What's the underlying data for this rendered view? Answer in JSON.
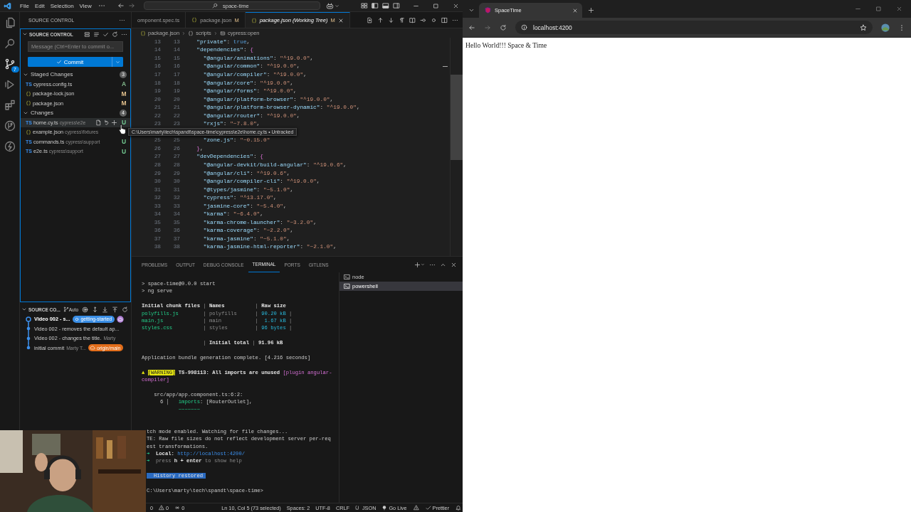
{
  "vscode": {
    "menu": [
      "File",
      "Edit",
      "Selection",
      "View"
    ],
    "command_center": "space-time",
    "activity_bar": [
      {
        "kind": "explorer",
        "selected": false
      },
      {
        "kind": "search",
        "selected": false
      },
      {
        "kind": "scm",
        "selected": true,
        "badge": "7"
      },
      {
        "kind": "run",
        "selected": false
      },
      {
        "kind": "extensions",
        "selected": false
      },
      {
        "kind": "gitlens",
        "selected": false
      },
      {
        "kind": "lightning",
        "selected": false
      }
    ],
    "sidebar": {
      "title": "SOURCE CONTROL",
      "section": "SOURCE CONTROL",
      "message_placeholder": "Message (Ctrl+Enter to commit o...",
      "commit_label": "Commit",
      "groups": [
        {
          "label": "Staged Changes",
          "count": "3",
          "expanded": true,
          "files": [
            {
              "kind": "ts",
              "icon_text": "TS",
              "name": "cypress.config.ts",
              "status": "A",
              "color": "#81b88b",
              "hovered": false
            },
            {
              "kind": "json",
              "name": "package-lock.json",
              "status": "M",
              "color": "#e2c08d",
              "hovered": false
            },
            {
              "kind": "json",
              "name": "package.json",
              "status": "M",
              "color": "#e2c08d",
              "hovered": false
            }
          ]
        },
        {
          "label": "Changes",
          "count": "4",
          "expanded": true,
          "files": [
            {
              "kind": "ts",
              "icon_text": "TS",
              "name": "home.cy.ts",
              "path": "cypress\\e2e",
              "status": "U",
              "color": "#73c991",
              "hovered": true
            },
            {
              "kind": "json",
              "name": "example.json",
              "path": "cypress\\fixtures",
              "hovered": false
            },
            {
              "kind": "ts",
              "icon_text": "TS",
              "name": "commands.ts",
              "path": "cypress\\support",
              "status": "U",
              "color": "#73c991",
              "hovered": false
            },
            {
              "kind": "ts",
              "icon_text": "TS",
              "name": "e2e.ts",
              "path": "cypress\\support",
              "status": "U",
              "color": "#73c991",
              "hovered": false
            }
          ]
        }
      ],
      "graph": {
        "title": "SOURCE CO...",
        "mode": "Auto",
        "commits": [
          {
            "message": "Video 002 - s...",
            "head": true,
            "remote": true,
            "ref": {
              "kind": "local",
              "label": "getting-started",
              "color": "#3a8ee6"
            }
          },
          {
            "message": "Video 002 - removes the default ap...",
            "head": false,
            "remote": false
          },
          {
            "message": "Video 002 - changes the title.",
            "author": "Marty",
            "head": false,
            "remote": false
          },
          {
            "message": "initial commit",
            "author": "Marty T...",
            "head": false,
            "remote": false,
            "ref": {
              "kind": "remote",
              "label": "origin/main",
              "color": "#e26d1a"
            }
          }
        ]
      }
    },
    "editor": {
      "tabs": [
        {
          "label": "omponent.spec.ts",
          "selected": false,
          "preview": false
        },
        {
          "kind": "json",
          "label": "package.json",
          "decoration": "M",
          "selected": false,
          "preview": false
        },
        {
          "kind": "json",
          "label": "package.json (Working Tree)",
          "decoration": "M",
          "selected": true,
          "preview": true
        }
      ],
      "breadcrumbs": [
        {
          "kind": "json",
          "label": "package.json"
        },
        {
          "kind": "object",
          "label": "scripts"
        },
        {
          "kind": "string",
          "label": "cypress:open"
        }
      ],
      "lines": [
        {
          "a": "13",
          "b": "13",
          "code": "  \"private\": true,"
        },
        {
          "a": "14",
          "b": "14",
          "code": "  \"dependencies\": {"
        },
        {
          "a": "15",
          "b": "15",
          "code": "    \"@angular/animations\": \"^19.0.0\","
        },
        {
          "a": "16",
          "b": "16",
          "code": "    \"@angular/common\": \"^19.0.0\","
        },
        {
          "a": "17",
          "b": "17",
          "code": "    \"@angular/compiler\": \"^19.0.0\","
        },
        {
          "a": "18",
          "b": "18",
          "code": "    \"@angular/core\": \"^19.0.0\","
        },
        {
          "a": "19",
          "b": "19",
          "code": "    \"@angular/forms\": \"^19.0.0\","
        },
        {
          "a": "20",
          "b": "20",
          "code": "    \"@angular/platform-browser\": \"^19.0.0\","
        },
        {
          "a": "21",
          "b": "21",
          "code": "    \"@angular/platform-browser-dynamic\": \"^19.0.0\","
        },
        {
          "a": "22",
          "b": "22",
          "code": "    \"@angular/router\": \"^19.0.0\","
        },
        {
          "a": "23",
          "b": "23",
          "code": "    \"rxjs\": \"~7.8.0\","
        },
        {
          "a": "25",
          "b": "25",
          "code": "    \"zone.js\": \"~0.15.0\""
        },
        {
          "a": "26",
          "b": "26",
          "code": "  },"
        },
        {
          "a": "27",
          "b": "27",
          "code": "  \"devDependencies\": {"
        },
        {
          "a": "28",
          "b": "28",
          "code": "    \"@angular-devkit/build-angular\": \"^19.0.6\","
        },
        {
          "a": "29",
          "b": "29",
          "code": "    \"@angular/cli\": \"^19.0.6\","
        },
        {
          "a": "30",
          "b": "30",
          "code": "    \"@angular/compiler-cli\": \"^19.0.0\","
        },
        {
          "a": "31",
          "b": "31",
          "code": "    \"@types/jasmine\": \"~5.1.0\","
        },
        {
          "a": "32",
          "b": "32",
          "code": "    \"cypress\": \"^13.17.0\","
        },
        {
          "a": "33",
          "b": "33",
          "code": "    \"jasmine-core\": \"~5.4.0\","
        },
        {
          "a": "34",
          "b": "34",
          "code": "    \"karma\": \"~6.4.0\","
        },
        {
          "a": "35",
          "b": "35",
          "code": "    \"karma-chrome-launcher\": \"~3.2.0\","
        },
        {
          "a": "36",
          "b": "36",
          "code": "    \"karma-coverage\": \"~2.2.0\","
        },
        {
          "a": "37",
          "b": "37",
          "code": "    \"karma-jasmine\": \"~5.1.0\","
        },
        {
          "a": "38",
          "b": "38",
          "code": "    \"karma-jasmine-html-reporter\": \"~2.1.0\","
        }
      ]
    },
    "tooltip": "C:\\Users\\marty\\tech\\spandt\\space-time\\cypress\\e2e\\home.cy.ts • Untracked",
    "panel": {
      "tabs": [
        {
          "label": "PROBLEMS",
          "selected": false
        },
        {
          "label": "OUTPUT",
          "selected": false
        },
        {
          "label": "DEBUG CONSOLE",
          "selected": false
        },
        {
          "label": "TERMINAL",
          "selected": true
        },
        {
          "label": "PORTS",
          "selected": false
        },
        {
          "label": "GITLENS",
          "selected": false
        }
      ],
      "terminal": [
        {
          "kind": "text",
          "covered": false,
          "segments": [
            {
              "kind": "plain",
              "text": "> space-time@0.0.0 start"
            }
          ]
        },
        {
          "kind": "text",
          "covered": false,
          "segments": [
            {
              "kind": "plain",
              "text": "> ng serve"
            }
          ]
        },
        {
          "kind": "blank"
        },
        {
          "kind": "text",
          "covered": false,
          "segments": [
            {
              "kind": "bold",
              "text": "Initial chunk files"
            },
            {
              "kind": "dim",
              "text": " | "
            },
            {
              "kind": "bold",
              "text": "Names"
            },
            {
              "kind": "dim",
              "text": "          | "
            },
            {
              "kind": "bold",
              "text": "Raw size"
            }
          ]
        },
        {
          "kind": "text",
          "covered": false,
          "segments": [
            {
              "kind": "green",
              "text": "polyfills.js"
            },
            {
              "kind": "dim",
              "text": "        | polyfills      | "
            },
            {
              "kind": "cyan",
              "text": "90.20 kB"
            },
            {
              "kind": "dim",
              "text": " |"
            }
          ]
        },
        {
          "kind": "text",
          "covered": false,
          "segments": [
            {
              "kind": "green",
              "text": "main.js"
            },
            {
              "kind": "dim",
              "text": "             | main           | "
            },
            {
              "kind": "cyan",
              "text": " 1.67 kB"
            },
            {
              "kind": "dim",
              "text": " |"
            }
          ]
        },
        {
          "kind": "text",
          "covered": false,
          "segments": [
            {
              "kind": "green",
              "text": "styles.css"
            },
            {
              "kind": "dim",
              "text": "          | styles         | "
            },
            {
              "kind": "cyan",
              "text": "96 bytes"
            },
            {
              "kind": "dim",
              "text": " |"
            }
          ]
        },
        {
          "kind": "blank"
        },
        {
          "kind": "text",
          "covered": false,
          "segments": [
            {
              "kind": "dim",
              "text": "                    | "
            },
            {
              "kind": "bold",
              "text": "Initial total"
            },
            {
              "kind": "dim",
              "text": " | "
            },
            {
              "kind": "bold",
              "text": "91.96 kB"
            }
          ]
        },
        {
          "kind": "blank"
        },
        {
          "kind": "text",
          "covered": false,
          "segments": [
            {
              "kind": "plain",
              "text": "Application bundle generation complete. [4.216 seconds]"
            }
          ]
        },
        {
          "kind": "blank"
        },
        {
          "kind": "text",
          "covered": false,
          "segments": [
            {
              "kind": "yellow",
              "text": "▲ "
            },
            {
              "kind": "badge",
              "text": "[WARNING]"
            },
            {
              "kind": "bold",
              "text": " TS-998113: All imports are unused "
            },
            {
              "kind": "magenta",
              "text": "[plugin angular-"
            }
          ]
        },
        {
          "kind": "text",
          "covered": false,
          "segments": [
            {
              "kind": "magenta",
              "text": "compiler]"
            }
          ]
        },
        {
          "kind": "blank"
        },
        {
          "kind": "text",
          "covered": false,
          "segments": [
            {
              "kind": "plain",
              "text": "    src/app/app.component.ts:6:2:"
            }
          ]
        },
        {
          "kind": "text",
          "covered": false,
          "segments": [
            {
              "kind": "plain",
              "text": "      6 │   "
            },
            {
              "kind": "green",
              "text": "imports"
            },
            {
              "kind": "plain",
              "text": ": [RouterOutlet],"
            }
          ]
        },
        {
          "kind": "text",
          "covered": false,
          "segments": [
            {
              "kind": "green",
              "text": "            ~~~~~~~"
            }
          ]
        },
        {
          "kind": "blank"
        },
        {
          "kind": "blank"
        },
        {
          "kind": "text",
          "covered": true,
          "segments": [
            {
              "kind": "plain",
              "text": "tch mode enabled. Watching for file changes..."
            }
          ]
        },
        {
          "kind": "text",
          "covered": true,
          "segments": [
            {
              "kind": "plain",
              "text": "TE: Raw file sizes do not reflect development server per-req"
            }
          ]
        },
        {
          "kind": "text",
          "covered": true,
          "segments": [
            {
              "kind": "plain",
              "text": "est transformations."
            }
          ]
        },
        {
          "kind": "text",
          "covered": true,
          "segments": [
            {
              "kind": "green",
              "text": "➜"
            },
            {
              "kind": "bold",
              "text": "  Local:"
            },
            {
              "kind": "link",
              "text": "   http://localhost:4200/"
            }
          ]
        },
        {
          "kind": "text",
          "covered": true,
          "segments": [
            {
              "kind": "green",
              "text": "➜"
            },
            {
              "kind": "dim",
              "text": "  press "
            },
            {
              "kind": "bold",
              "text": "h + enter"
            },
            {
              "kind": "dim",
              "text": " to show help"
            }
          ]
        },
        {
          "kind": "blank"
        },
        {
          "kind": "text",
          "covered": true,
          "segments": [
            {
              "kind": "selection",
              "text": "History restored"
            }
          ]
        },
        {
          "kind": "blank"
        },
        {
          "kind": "text",
          "covered": true,
          "segments": [
            {
              "kind": "plain",
              "text": "C:\\Users\\marty\\tech\\spandt\\space-time>"
            }
          ]
        }
      ],
      "sessions": [
        {
          "label": "node",
          "selected": false
        },
        {
          "label": "powershell",
          "selected": true
        }
      ]
    },
    "status_bar": [
      {
        "kind": "count",
        "text": "0"
      },
      {
        "kind": "warnings",
        "text": "0"
      },
      {
        "kind": "ports",
        "text": "0"
      },
      {
        "kind": "plain",
        "text": "Ln 10, Col 5 (73 selected)"
      },
      {
        "kind": "plain",
        "text": "Spaces: 2"
      },
      {
        "kind": "plain",
        "text": "UTF-8"
      },
      {
        "kind": "plain",
        "text": "CRLF"
      },
      {
        "kind": "language",
        "text": "JSON"
      },
      {
        "kind": "golive",
        "text": "Go Live"
      },
      {
        "kind": "alert"
      },
      {
        "kind": "prettier",
        "text": "Prettier"
      },
      {
        "kind": "bell"
      }
    ]
  },
  "browser": {
    "tab": "SpaceTime",
    "url": "localhost:4200",
    "content": "Hello World!!! Space & Time"
  }
}
